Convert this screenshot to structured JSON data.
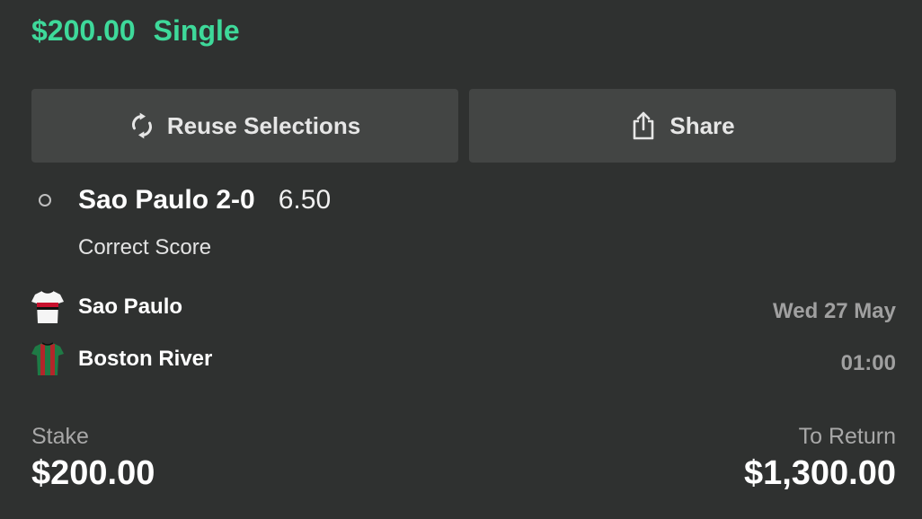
{
  "header": {
    "amount": "$200.00",
    "bet_type": "Single",
    "accent_color": "#3ed99a"
  },
  "actions": {
    "reuse_label": "Reuse Selections",
    "reuse_icon": "refresh-icon",
    "share_label": "Share",
    "share_icon": "share-icon"
  },
  "selection": {
    "name": "Sao Paulo 2-0",
    "odds": "6.50",
    "market": "Correct Score"
  },
  "event": {
    "home_team": "Sao Paulo",
    "away_team": "Boston River",
    "date": "Wed 27 May",
    "time": "01:00"
  },
  "summary": {
    "stake_label": "Stake",
    "stake_value": "$200.00",
    "return_label": "To Return",
    "return_value": "$1,300.00"
  }
}
